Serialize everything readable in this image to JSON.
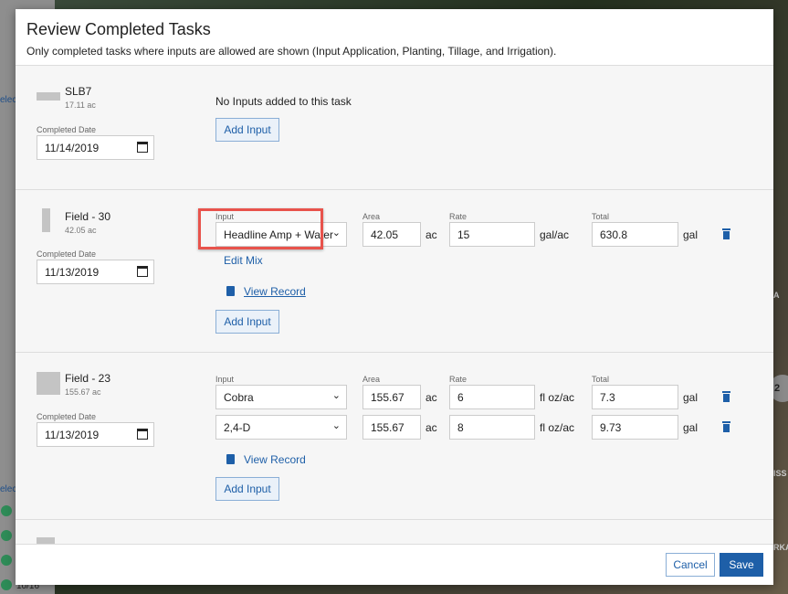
{
  "background": {
    "sidebar_label": "elec",
    "sidebar_label_2": "elec",
    "sidebar_count": "10/16",
    "map_badge": "2",
    "map_labels": [
      "A",
      "ISS",
      "RKA"
    ]
  },
  "modal": {
    "title": "Review Completed Tasks",
    "subtitle": "Only completed tasks where inputs are allowed are shown (Input Application, Planting, Tillage, and Irrigation)."
  },
  "labels": {
    "completed_date": "Completed Date",
    "input": "Input",
    "area": "Area",
    "rate": "Rate",
    "total": "Total",
    "add_input": "Add Input",
    "edit_mix": "Edit Mix",
    "view_record": "View Record",
    "no_inputs": "No Inputs added to this task"
  },
  "tasks": [
    {
      "name": "SLB7",
      "acres": "17.11 ac",
      "date": "11/14/2019",
      "inputs": []
    },
    {
      "name": "Field - 30",
      "acres": "42.05 ac",
      "date": "11/13/2019",
      "inputs": [
        {
          "product": "Headline Amp + Water",
          "area": "42.05",
          "area_unit": "ac",
          "rate": "15",
          "rate_unit": "gal/ac",
          "total": "630.8",
          "total_unit": "gal"
        }
      ]
    },
    {
      "name": "Field - 23",
      "acres": "155.67 ac",
      "date": "11/13/2019",
      "inputs": [
        {
          "product": "Cobra",
          "area": "155.67",
          "area_unit": "ac",
          "rate": "6",
          "rate_unit": "fl oz/ac",
          "total": "7.3",
          "total_unit": "gal"
        },
        {
          "product": "2,4-D",
          "area": "155.67",
          "area_unit": "ac",
          "rate": "8",
          "rate_unit": "fl oz/ac",
          "total": "9.73",
          "total_unit": "gal"
        }
      ]
    }
  ],
  "footer": {
    "cancel": "Cancel",
    "save": "Save"
  },
  "colors": {
    "accent": "#1e5fa8",
    "highlight": "#e8534c"
  }
}
